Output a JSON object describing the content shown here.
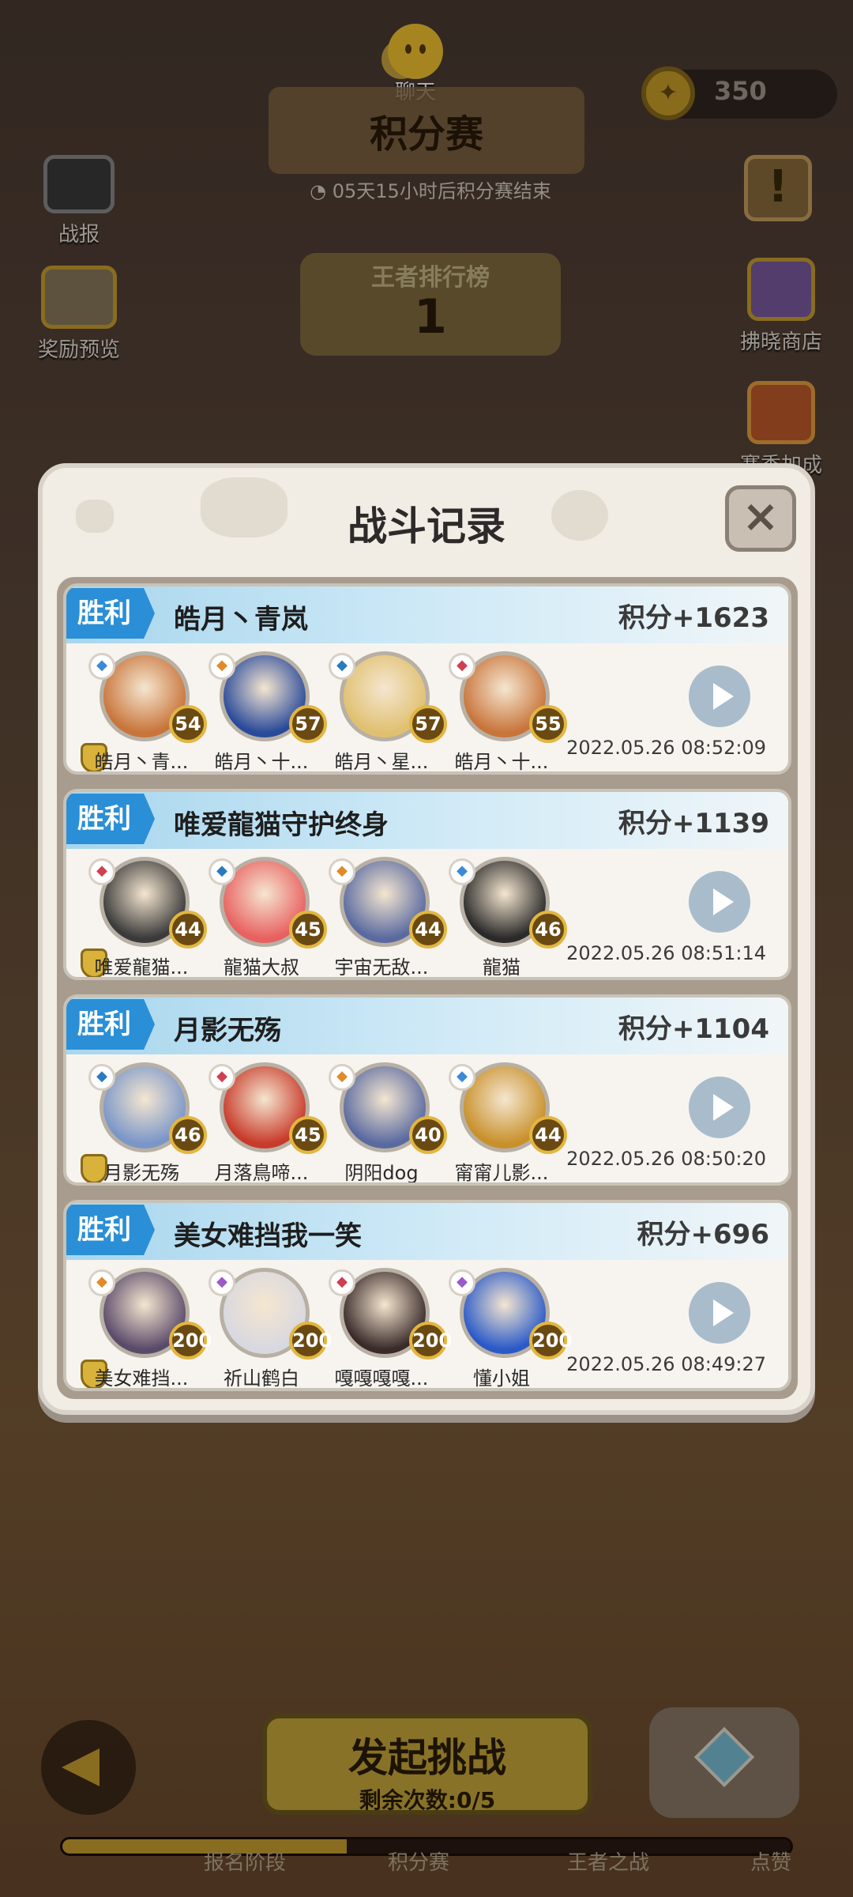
{
  "header": {
    "chat_label": "聊天",
    "coins": "350",
    "title": "积分赛",
    "timer": "05天15小时后积分赛结束",
    "rank_title": "王者排行榜",
    "rank_value": "1"
  },
  "side_left": [
    {
      "label": "战报",
      "icon": "tv-icon"
    },
    {
      "label": "奖励预览",
      "icon": "chest-icon"
    }
  ],
  "side_right": [
    {
      "label": "拂晓商店",
      "icon": "shop-icon"
    },
    {
      "label": "赛季加成",
      "icon": "boost-icon"
    }
  ],
  "modal": {
    "title": "战斗记录",
    "close_icon": "close-icon",
    "result_label": "胜利",
    "records": [
      {
        "player": "皓月丶青岚",
        "score": "积分+1623",
        "time": "2022.05.26 08:52:09",
        "heroes": [
          {
            "name": "皓月丶青...",
            "level": "54",
            "class_color": "#3a8ad6"
          },
          {
            "name": "皓月丶十...",
            "level": "57",
            "class_color": "#e08a2a"
          },
          {
            "name": "皓月丶星...",
            "level": "57",
            "class_color": "#2a7ac0"
          },
          {
            "name": "皓月丶十...",
            "level": "55",
            "class_color": "#d04050"
          }
        ]
      },
      {
        "player": "唯爱龍猫守护终身",
        "score": "积分+1139",
        "time": "2022.05.26 08:51:14",
        "heroes": [
          {
            "name": "唯爱龍猫...",
            "level": "44",
            "class_color": "#d04050"
          },
          {
            "name": "龍猫大叔",
            "level": "45",
            "class_color": "#2a7ac0"
          },
          {
            "name": "宇宙无敌...",
            "level": "44",
            "class_color": "#e08a2a"
          },
          {
            "name": "龍猫",
            "level": "46",
            "class_color": "#3a8ad6"
          }
        ]
      },
      {
        "player": "月影无殇",
        "score": "积分+1104",
        "time": "2022.05.26 08:50:20",
        "heroes": [
          {
            "name": "月影无殇",
            "level": "46",
            "class_color": "#2a7ac0"
          },
          {
            "name": "月落鳥啼...",
            "level": "45",
            "class_color": "#d04050"
          },
          {
            "name": "阴阳dog",
            "level": "40",
            "class_color": "#e08a2a"
          },
          {
            "name": "甯甯儿影...",
            "level": "44",
            "class_color": "#3a8ad6"
          }
        ]
      },
      {
        "player": "美女难挡我一笑",
        "score": "积分+696",
        "time": "2022.05.26 08:49:27",
        "heroes": [
          {
            "name": "美女难挡...",
            "level": "200",
            "class_color": "#e08a2a"
          },
          {
            "name": "祈山鹤白",
            "level": "200",
            "class_color": "#9a5ac8"
          },
          {
            "name": "嘎嘎嘎嘎...",
            "level": "200",
            "class_color": "#d04050"
          },
          {
            "name": "懂小姐",
            "level": "200",
            "class_color": "#9a5ac8"
          }
        ]
      }
    ]
  },
  "bottom": {
    "challenge_label": "发起挑战",
    "remaining": "剩余次数:0/5",
    "progress_fraction": 0.39,
    "stages": [
      "报名阶段",
      "积分赛",
      "王者之战",
      "点赞"
    ]
  },
  "colors": {
    "win_tag": "#2a8fd6",
    "modal_bg": "#f1ece4",
    "gold": "#c9a030"
  }
}
